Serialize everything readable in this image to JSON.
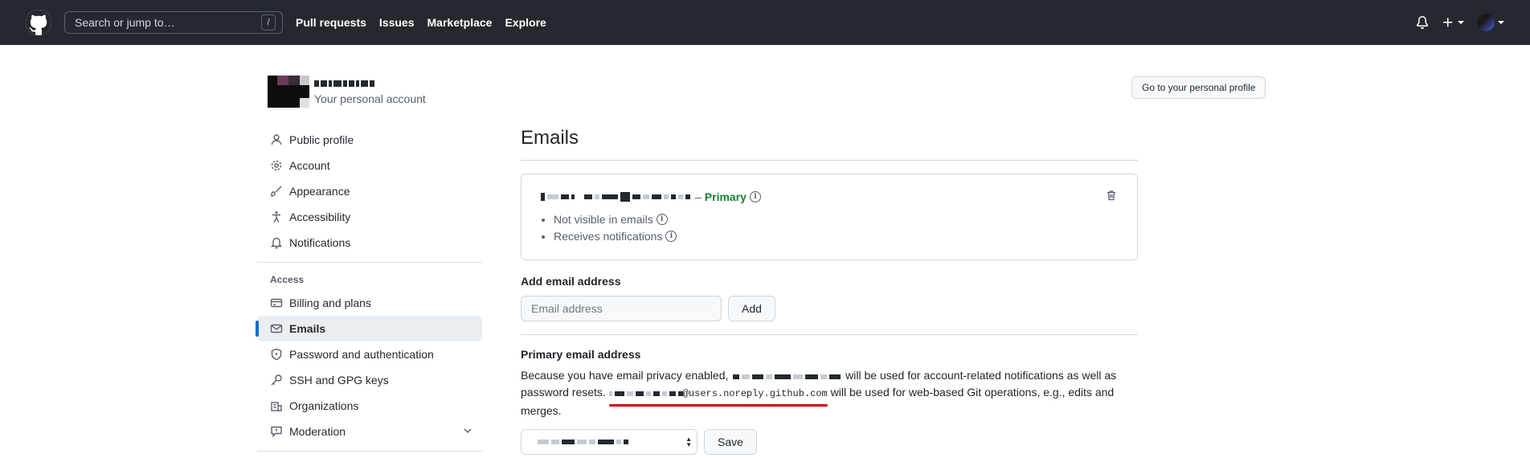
{
  "header": {
    "search_placeholder": "Search or jump to…",
    "search_shortcut": "/",
    "nav": [
      "Pull requests",
      "Issues",
      "Marketplace",
      "Explore"
    ]
  },
  "account": {
    "subtitle": "Your personal account",
    "profile_button": "Go to your personal profile"
  },
  "sidebar": {
    "items_top": [
      {
        "label": "Public profile",
        "icon": "person-icon"
      },
      {
        "label": "Account",
        "icon": "gear-icon"
      },
      {
        "label": "Appearance",
        "icon": "paintbrush-icon"
      },
      {
        "label": "Accessibility",
        "icon": "accessibility-icon"
      },
      {
        "label": "Notifications",
        "icon": "bell-icon"
      }
    ],
    "group_access": "Access",
    "items_access": [
      {
        "label": "Billing and plans",
        "icon": "credit-card-icon"
      },
      {
        "label": "Emails",
        "icon": "mail-icon",
        "active": true
      },
      {
        "label": "Password and authentication",
        "icon": "shield-lock-icon"
      },
      {
        "label": "SSH and GPG keys",
        "icon": "key-icon"
      },
      {
        "label": "Organizations",
        "icon": "organization-icon"
      },
      {
        "label": "Moderation",
        "icon": "report-icon"
      }
    ]
  },
  "main": {
    "title": "Emails",
    "primary_label": "Primary",
    "email_separator": "–",
    "email_notes": [
      "Not visible in emails",
      "Receives notifications"
    ],
    "add_email_heading": "Add email address",
    "add_email_placeholder": "Email address",
    "add_button": "Add",
    "primary_heading": "Primary email address",
    "para_1": "Because you have email privacy enabled,",
    "para_2": "will be used for account-related notifications as well as password resets.",
    "noreply_suffix": "@users.noreply.github.com",
    "para_3": "will be used for web-based Git operations, e.g., edits and merges.",
    "save_button": "Save"
  },
  "colors": {
    "header_bg": "#24292f",
    "accent": "#0969da",
    "primary_green": "#1a7f37",
    "annotation_red": "#d00000"
  }
}
